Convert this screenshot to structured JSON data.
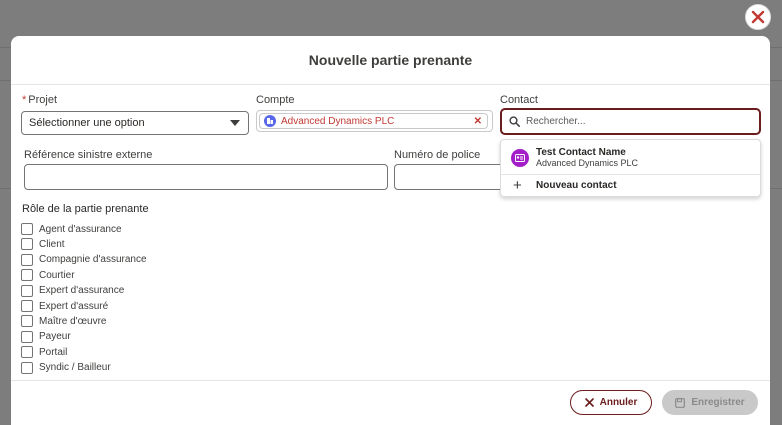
{
  "modal": {
    "title": "Nouvelle partie prenante"
  },
  "fields": {
    "projet": {
      "label": "Projet",
      "required_mark": "*",
      "value": "Sélectionner une option"
    },
    "compte": {
      "label": "Compte",
      "pill": "Advanced Dynamics PLC"
    },
    "contact": {
      "label": "Contact",
      "placeholder": "Rechercher..."
    },
    "reference": {
      "label": "Référence sinistre externe"
    },
    "police": {
      "label": "Numéro de police"
    }
  },
  "contact_dropdown": {
    "result_name": "Test Contact Name",
    "result_account": "Advanced Dynamics PLC",
    "new_contact": "Nouveau contact"
  },
  "roles": {
    "title": "Rôle de la partie prenante",
    "options": [
      "Agent d'assurance",
      "Client",
      "Compagnie d'assurance",
      "Courtier",
      "Expert d'assurance",
      "Expert d'assuré",
      "Maître d'œuvre",
      "Payeur",
      "Portail",
      "Syndic / Bailleur"
    ]
  },
  "footer": {
    "cancel": "Annuler",
    "save": "Enregistrer"
  },
  "colors": {
    "accent": "#6b1d1d",
    "required": "#c23934",
    "account_icon": "#5867e8",
    "contact_icon": "#a31dc8",
    "disabled": "#c9c9c9"
  }
}
